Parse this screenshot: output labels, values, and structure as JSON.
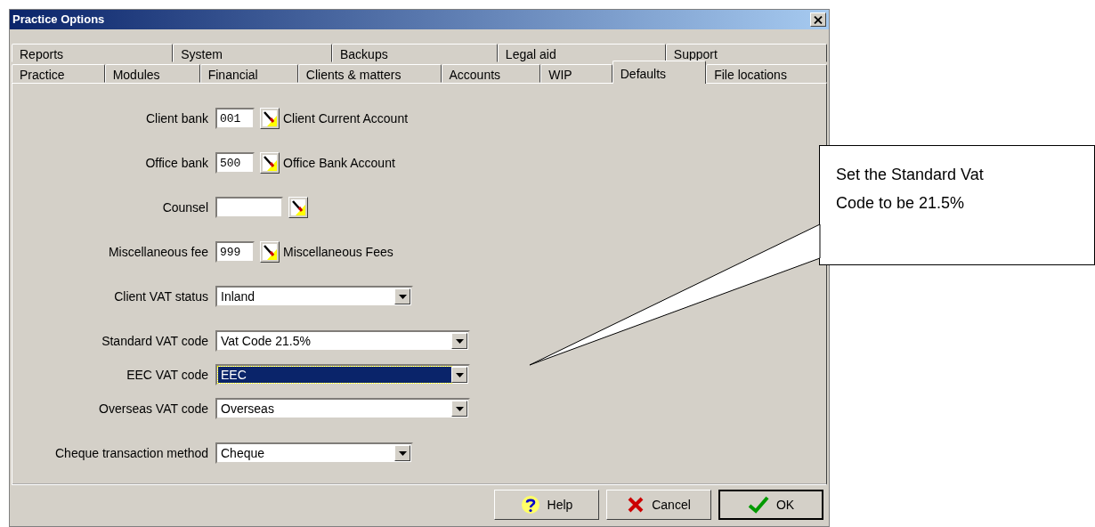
{
  "window": {
    "title": "Practice Options"
  },
  "tab_rows": [
    [
      {
        "label": "Reports",
        "selected": false
      },
      {
        "label": "System",
        "selected": false
      },
      {
        "label": "Backups",
        "selected": false
      },
      {
        "label": "Legal aid",
        "selected": false
      },
      {
        "label": "Support",
        "selected": false
      }
    ],
    [
      {
        "label": "Practice",
        "selected": false
      },
      {
        "label": "Modules",
        "selected": false
      },
      {
        "label": "Financial",
        "selected": false
      },
      {
        "label": "Clients & matters",
        "selected": false
      },
      {
        "label": "Accounts",
        "selected": false
      },
      {
        "label": "WIP",
        "selected": false
      },
      {
        "label": "Defaults",
        "selected": true
      },
      {
        "label": "File locations",
        "selected": false
      }
    ]
  ],
  "field_groups": [
    [
      {
        "kind": "lookup",
        "label": "Client bank",
        "value": "001",
        "description": "Client Current Account"
      }
    ],
    [
      {
        "kind": "lookup",
        "label": "Office bank",
        "value": "500",
        "description": "Office Bank Account"
      }
    ],
    [
      {
        "kind": "lookup",
        "label": "Counsel"
      }
    ],
    [
      {
        "kind": "lookup",
        "label": "Miscellaneous fee",
        "value": "999",
        "description": "Miscellaneous Fees"
      }
    ],
    [
      {
        "kind": "dropdown",
        "label": "Client VAT status",
        "value": "Inland",
        "focused": false
      }
    ],
    [
      {
        "kind": "dropdown",
        "label": "Standard VAT code",
        "value": "Vat Code 21.5%",
        "focused": false,
        "wide": true
      },
      {
        "kind": "dropdown",
        "label": "EEC VAT code",
        "value": "EEC",
        "focused": true,
        "wide": true
      },
      {
        "kind": "dropdown",
        "label": "Overseas VAT code",
        "value": "Overseas",
        "focused": false,
        "wide": true
      }
    ],
    [
      {
        "kind": "dropdown",
        "label": "Cheque transaction method",
        "value": "Cheque",
        "focused": false
      }
    ]
  ],
  "buttons": [
    {
      "kind": "help",
      "label": "Help",
      "default": false
    },
    {
      "kind": "cancel",
      "label": "Cancel",
      "default": false
    },
    {
      "kind": "ok",
      "label": "OK",
      "default": true
    }
  ],
  "callout": {
    "text": "Set the Standard Vat Code to be 21.5%"
  }
}
